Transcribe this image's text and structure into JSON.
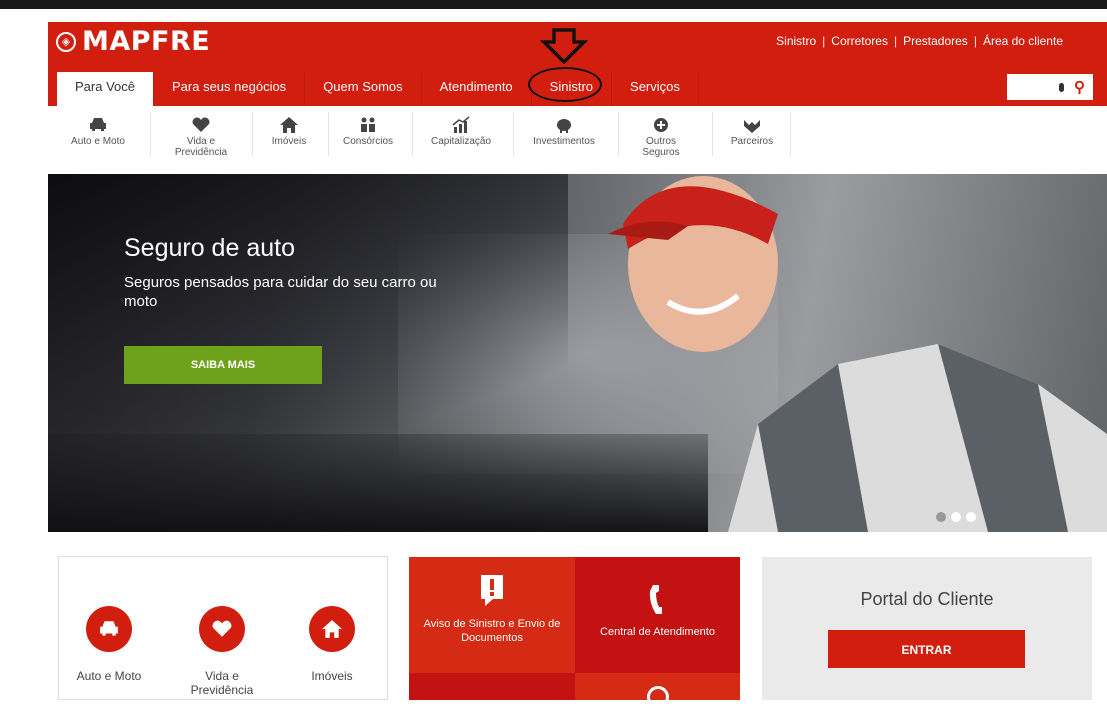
{
  "brand": {
    "name": "MAPFRE"
  },
  "top_links": [
    "Sinistro",
    "Corretores",
    "Prestadores",
    "Área do cliente"
  ],
  "nav_tabs": [
    "Para Você",
    "Para seus negócios",
    "Quem Somos",
    "Atendimento",
    "Sinistro",
    "Serviços"
  ],
  "sub_nav": [
    {
      "label": "Auto e Moto",
      "icon": "car-icon"
    },
    {
      "label": "Vida e Previdência",
      "icon": "heart-icon"
    },
    {
      "label": "Imóveis",
      "icon": "house-icon"
    },
    {
      "label": "Consórcios",
      "icon": "people-icon"
    },
    {
      "label": "Capitalização",
      "icon": "growth-chart-icon"
    },
    {
      "label": "Investimentos",
      "icon": "piggy-bank-icon"
    },
    {
      "label": "Outros Seguros",
      "icon": "plus-circle-icon"
    },
    {
      "label": "Parceiros",
      "icon": "handshake-icon"
    }
  ],
  "hero": {
    "title": "Seguro de auto",
    "subtitle": "Seguros pensados para cuidar do seu carro ou moto",
    "button": "SAIBA MAIS",
    "slide_count": 3,
    "active_slide": 2
  },
  "quick_icons": [
    {
      "label": "Auto e Moto",
      "icon": "car-icon"
    },
    {
      "label": "Vida e Previdência",
      "icon": "heart-icon"
    },
    {
      "label": "Imóveis",
      "icon": "house-icon"
    }
  ],
  "services": [
    {
      "label": "Aviso de Sinistro e Envio de Documentos",
      "icon": "alert-icon"
    },
    {
      "label": "Central de Atendimento",
      "icon": "phone-icon"
    }
  ],
  "portal": {
    "title": "Portal do Cliente",
    "button": "ENTRAR"
  },
  "colors": {
    "brand_red": "#d21e0f",
    "cta_green": "#6ea21a",
    "portal_bg": "#eaeaea"
  }
}
